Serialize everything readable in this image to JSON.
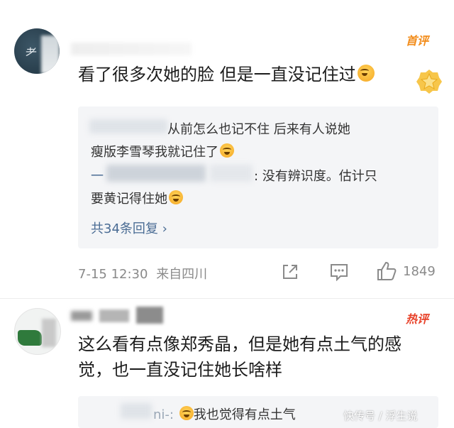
{
  "comment1": {
    "avatar_glyph": "耂",
    "badge": "首评",
    "text": "看了很多次她的脸 但是一直没记住过",
    "replies": [
      {
        "line1": "从前怎么也记不住 后来有人说她",
        "line2": "瘦版李雪琴我就记住了"
      },
      {
        "name": "一",
        "line1": ": 没有辨识度。估计只",
        "line2": "要黄记得住她"
      }
    ],
    "reply_count": "共34条回复 ›",
    "date": "7-15 12:30",
    "source": "来自四川",
    "likes": "1849",
    "icons": [
      "forward-icon",
      "comment-icon",
      "like-icon"
    ]
  },
  "comment2": {
    "badge": "热评",
    "text": "这么看有点像郑秀晶，但是她有点土气的感觉，也一直没记住她长啥样",
    "reply": {
      "name": "ni-:",
      "text": "我也觉得有点土气"
    }
  },
  "watermark": "快传号 / 浮生说",
  "colors": {
    "first_badge": "#f28c1a",
    "hot_badge": "#e8422a",
    "link": "#4a6c94",
    "meta": "#8a8a8a"
  }
}
